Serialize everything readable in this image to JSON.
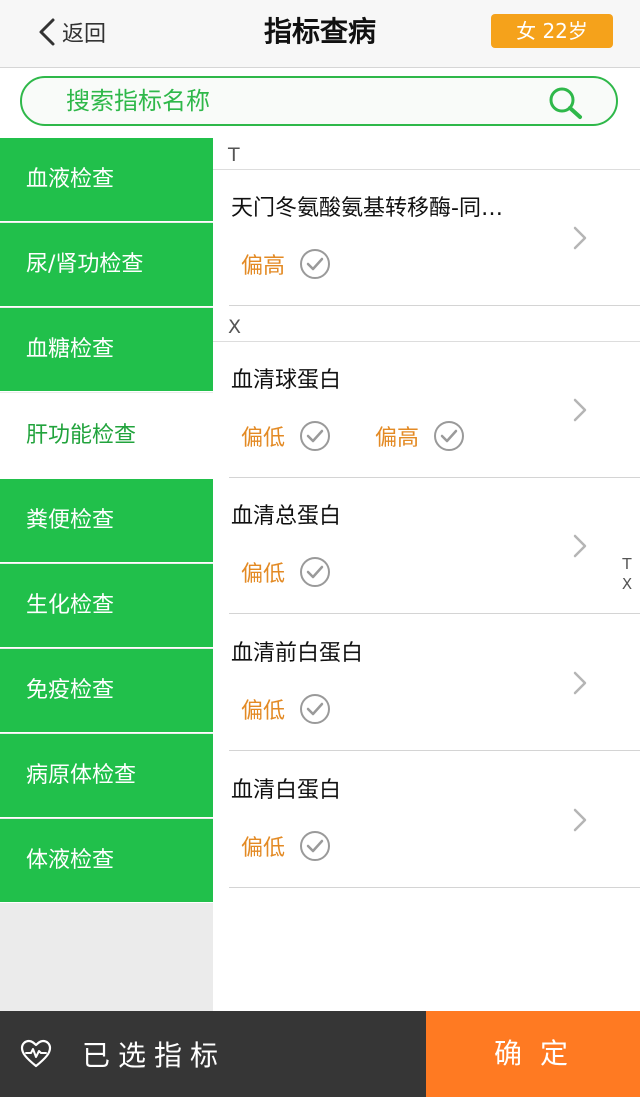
{
  "header": {
    "back_label": "返回",
    "title": "指标查病",
    "profile_badge": "女 22岁"
  },
  "search": {
    "placeholder": "搜索指标名称",
    "value": ""
  },
  "sidebar": {
    "items": [
      {
        "label": "血液检查",
        "active": false
      },
      {
        "label": "尿/肾功检查",
        "active": false
      },
      {
        "label": "血糖检查",
        "active": false
      },
      {
        "label": "肝功能检查",
        "active": true
      },
      {
        "label": "粪便检查",
        "active": false
      },
      {
        "label": "生化检查",
        "active": false
      },
      {
        "label": "免疫检查",
        "active": false
      },
      {
        "label": "病原体检查",
        "active": false
      },
      {
        "label": "体液检查",
        "active": false
      }
    ]
  },
  "list": {
    "sections": [
      {
        "letter": "T"
      },
      {
        "letter": "X"
      }
    ],
    "rows": [
      {
        "name": "天门冬氨酸氨基转移酶-同…",
        "tags": [
          "偏高"
        ]
      },
      {
        "name": "血清球蛋白",
        "tags": [
          "偏低",
          "偏高"
        ]
      },
      {
        "name": "血清总蛋白",
        "tags": [
          "偏低"
        ]
      },
      {
        "name": "血清前白蛋白",
        "tags": [
          "偏低"
        ]
      },
      {
        "name": "血清白蛋白",
        "tags": [
          "偏低"
        ]
      }
    ]
  },
  "index_bar": [
    "T",
    "X"
  ],
  "bottom": {
    "selected_label": "已选指标",
    "confirm_label": "确定"
  },
  "colors": {
    "accent_green": "#21c04b",
    "badge_orange": "#f5a21b",
    "confirm_orange": "#ff7a22",
    "tag_orange": "#e38a24",
    "bottom_bar": "#363636"
  },
  "icons": {
    "back": "chevron-left-icon",
    "search": "search-icon",
    "tag_check": "check-circle-icon",
    "row_arrow": "chevron-right-icon",
    "selected": "heart-pulse-icon"
  }
}
